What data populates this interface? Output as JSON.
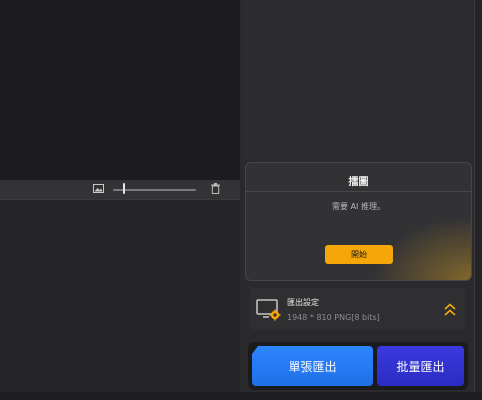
{
  "preview_toolbar": {
    "image_icon": "image-icon",
    "slider_value": 0.12,
    "trash_icon": "trash-icon"
  },
  "ai_card": {
    "title": "擂圖",
    "note": "需要 AI 推理。",
    "start_label": "開始"
  },
  "export_settings": {
    "icon": "display-gear-icon",
    "title": "匯出設定",
    "detail": "1948 *  810 PNG[8 bits]",
    "expand_icon": "chevrons-up-icon"
  },
  "export_buttons": {
    "single_label": "單張匯出",
    "batch_label": "批量匯出"
  },
  "colors": {
    "accent_orange": "#f5a70a",
    "single_blue": "#2d86ff",
    "batch_indigo": "#3a3ae0"
  }
}
